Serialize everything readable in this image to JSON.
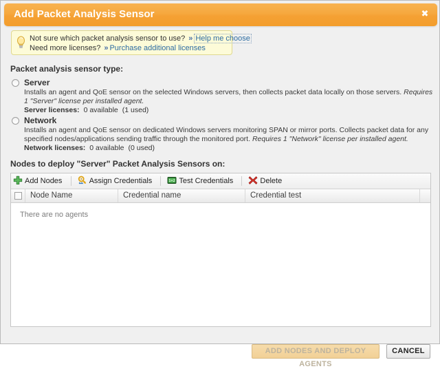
{
  "window": {
    "title": "Add Packet Analysis Sensor",
    "close_label": "✖",
    "accent_color": "#f5a134",
    "background_color": "#f0f0f0"
  },
  "tip": {
    "icon": "lightbulb-icon",
    "line1_text": "Not sure which packet analysis sensor to use?",
    "line1_chevron": "»",
    "line1_link": "Help me choose",
    "line2_text": "Need more licenses?",
    "line2_chevron": "»",
    "line2_link": "Purchase additional licenses",
    "link_color": "#2d6ca2",
    "background_color": "#fdfbd8"
  },
  "sensor_type": {
    "heading": "Packet analysis sensor type:",
    "options": [
      {
        "id": "server",
        "label": "Server",
        "description": "Installs an agent and QoE sensor on the selected Windows servers, then collects packet data locally on those servers.",
        "description_italic": "Requires 1 \"Server\" license per installed agent.",
        "license_label": "Server licenses:",
        "license_available": "0 available",
        "license_used": "(1 used)",
        "selected": false
      },
      {
        "id": "network",
        "label": "Network",
        "description": "Installs an agent and QoE sensor on dedicated Windows servers monitoring SPAN or mirror ports.  Collects packet data for any specified nodes/applications sending traffic through the monitored port.",
        "description_italic": "Requires 1 \"Network\" license per installed agent.",
        "license_label": "Network licenses:",
        "license_available": "0 available",
        "license_used": "(0 used)",
        "selected": false
      }
    ]
  },
  "nodes_section": {
    "heading": "Nodes to deploy \"Server\" Packet Analysis Sensors on:",
    "toolbar": [
      {
        "icon": "plus-icon",
        "label": "Add Nodes"
      },
      {
        "icon": "key-icon",
        "label": "Assign Credentials"
      },
      {
        "icon": "test-icon",
        "label": "Test Credentials"
      },
      {
        "icon": "red-x-icon",
        "label": "Delete"
      }
    ],
    "columns": [
      "Node Name",
      "Credential name",
      "Credential test"
    ],
    "rows": [],
    "empty_message": "There are no agents"
  },
  "footer": {
    "primary_label": "ADD NODES AND DEPLOY AGENTS",
    "primary_disabled": true,
    "cancel_label": "CANCEL"
  }
}
